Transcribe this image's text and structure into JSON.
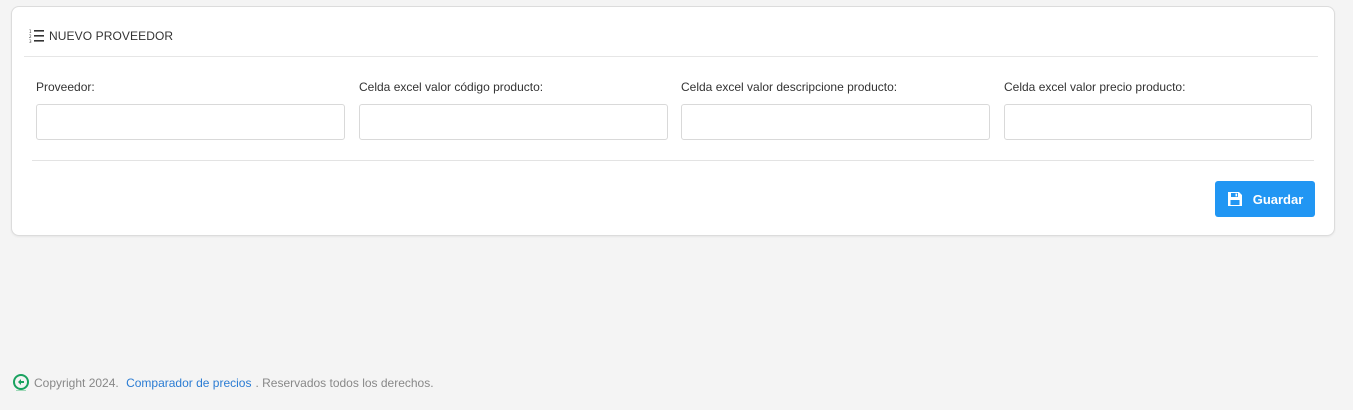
{
  "card": {
    "title": "NUEVO PROVEEDOR",
    "title_icon": "list-icon"
  },
  "form": {
    "fields": [
      {
        "label": "Proveedor:",
        "value": "",
        "placeholder": ""
      },
      {
        "label": "Celda excel valor código producto:",
        "value": "",
        "placeholder": ""
      },
      {
        "label": "Celda excel valor descripcione producto:",
        "value": "",
        "placeholder": ""
      },
      {
        "label": "Celda excel valor precio producto:",
        "value": "",
        "placeholder": ""
      }
    ],
    "save_label": "Guardar",
    "save_icon": "floppy-disk-icon"
  },
  "footer": {
    "logo_icon": "brand-logo-icon",
    "copyright": "Copyright 2024. ",
    "link_text": "Comparador de precios",
    "rights": ". Reservados todos los derechos."
  },
  "colors": {
    "page_background": "#f4f4f4",
    "card_background": "#ffffff",
    "primary_button": "#2196f3",
    "link": "#2b7cd3",
    "footer_text": "#888888",
    "logo_green": "#1aa260"
  }
}
